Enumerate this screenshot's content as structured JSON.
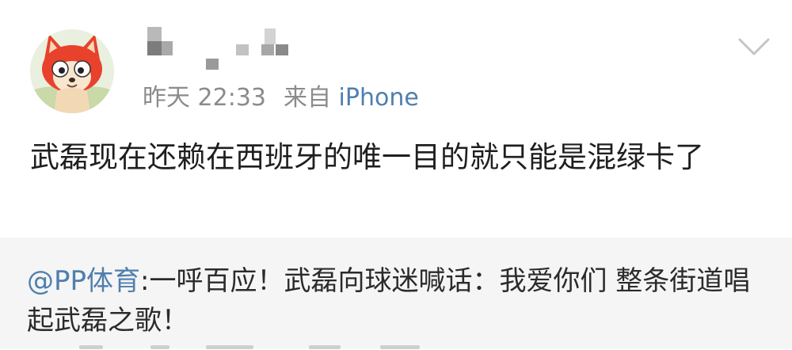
{
  "post": {
    "avatar_icon": "red-fox-cartoon-avatar",
    "username": "",
    "time": "昨天 22:33",
    "source_prefix": "来自",
    "source": "iPhone",
    "text": "武磊现在还赖在西班牙的唯一目的就只能是混绿卡了",
    "menu_icon": "chevron-down-icon"
  },
  "repost": {
    "mention": "@PP体育",
    "text": ":一呼百应！武磊向球迷喊话：我爱你们 整条街道唱起武磊之歌！"
  },
  "colors": {
    "link": "#4f7fae",
    "meta": "#8b8b8b",
    "text": "#1f1f1f",
    "repost_bg": "#f5f5f5"
  }
}
